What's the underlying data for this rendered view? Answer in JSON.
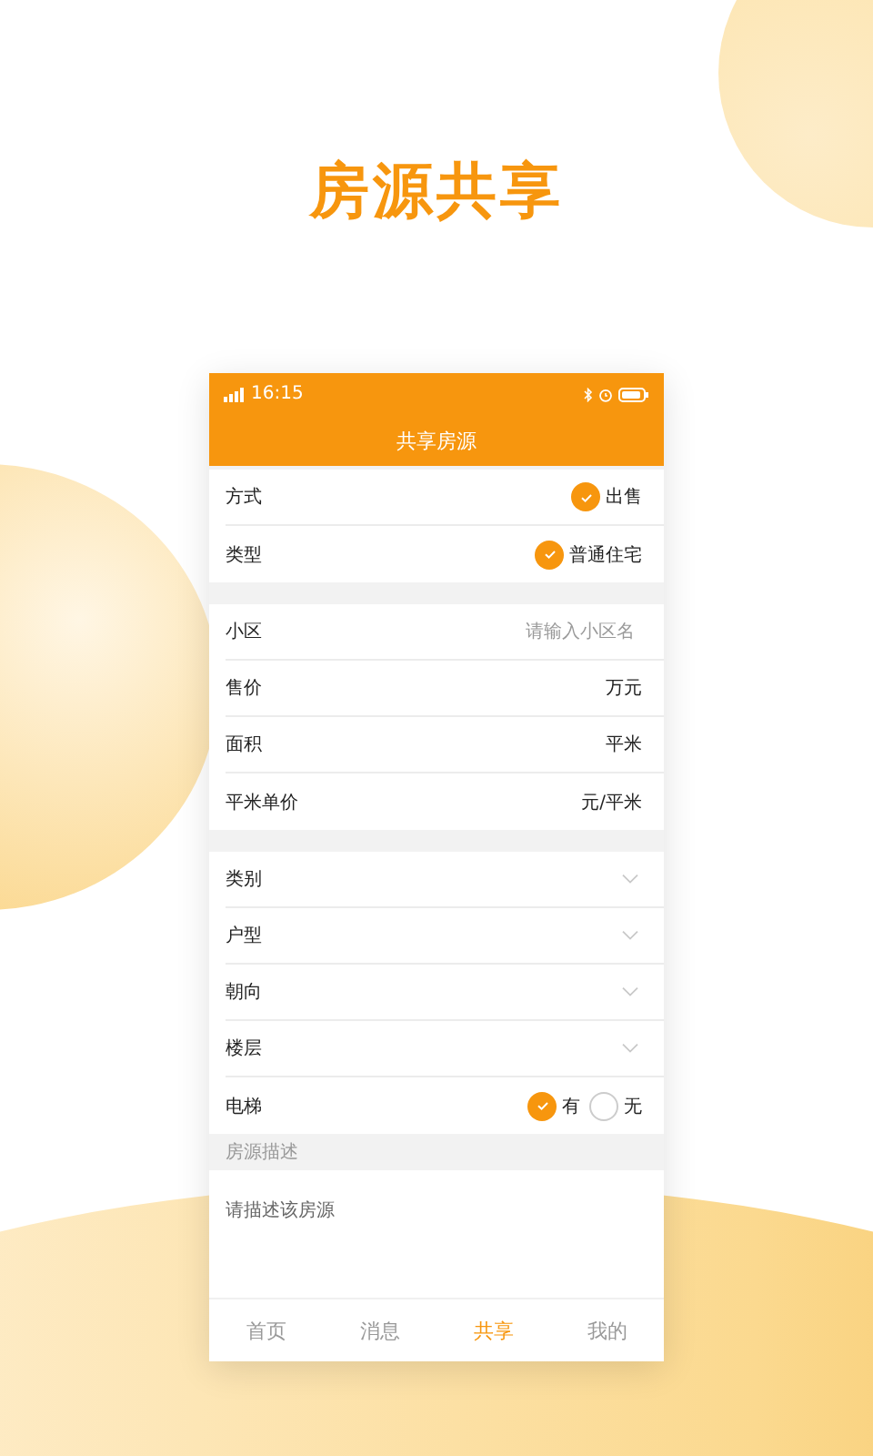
{
  "headline": "房源共享",
  "status_bar": {
    "time": "16:15"
  },
  "nav_bar": {
    "title": "共享房源"
  },
  "sections": [
    {
      "rows": [
        {
          "kind": "radio",
          "label": "方式",
          "options": [
            {
              "label": "出售",
              "selected": true
            }
          ]
        },
        {
          "kind": "radio",
          "label": "类型",
          "options": [
            {
              "label": "普通住宅",
              "selected": true
            }
          ]
        }
      ]
    },
    {
      "rows": [
        {
          "kind": "input",
          "label": "小区",
          "placeholder": "请输入小区名"
        },
        {
          "kind": "input",
          "label": "售价",
          "unit": "万元"
        },
        {
          "kind": "input",
          "label": "面积",
          "unit": "平米"
        },
        {
          "kind": "input",
          "label": "平米单价",
          "unit": "元/平米"
        }
      ]
    },
    {
      "rows": [
        {
          "kind": "select",
          "label": "类别"
        },
        {
          "kind": "select",
          "label": "户型"
        },
        {
          "kind": "select",
          "label": "朝向"
        },
        {
          "kind": "select",
          "label": "楼层"
        },
        {
          "kind": "radio",
          "label": "电梯",
          "options": [
            {
              "label": "有",
              "selected": true
            },
            {
              "label": "无",
              "selected": false
            }
          ]
        }
      ]
    }
  ],
  "description": {
    "header": "房源描述",
    "placeholder": "请描述该房源"
  },
  "tab_bar": [
    {
      "label": "首页",
      "selected": false
    },
    {
      "label": "消息",
      "selected": false
    },
    {
      "label": "共享",
      "selected": true
    },
    {
      "label": "我的",
      "selected": false
    }
  ]
}
